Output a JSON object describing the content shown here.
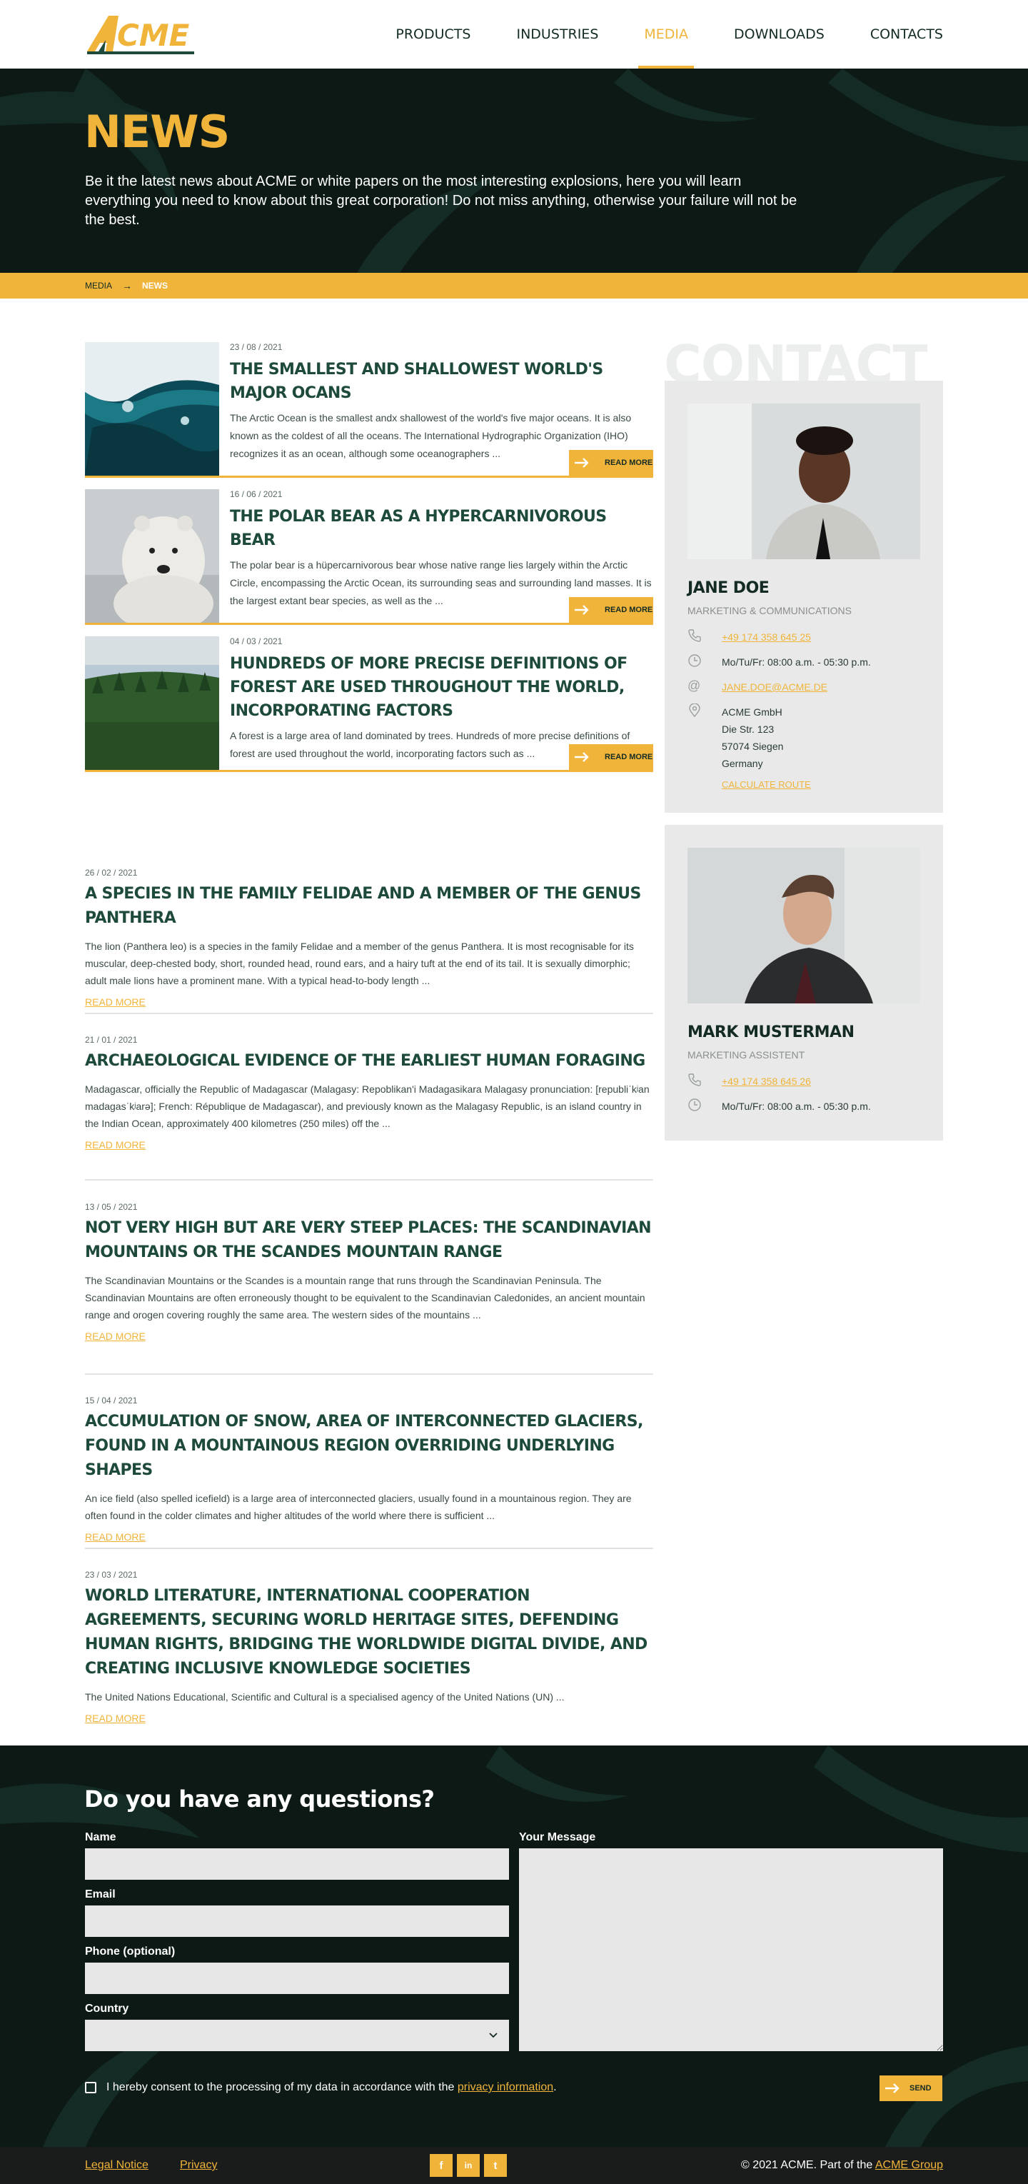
{
  "header": {
    "logo_text": "ACME",
    "nav": [
      "PRODUCTS",
      "INDUSTRIES",
      "MEDIA",
      "DOWNLOADS",
      "CONTACTS"
    ],
    "active_nav": "MEDIA"
  },
  "hero": {
    "title": "NEWS",
    "text": "Be it the latest news about ACME or white papers on the most interesting explosions, here you will learn everything you need to know about this great corporation! Do not miss anything, otherwise your failure will not be the best."
  },
  "breadcrumb": {
    "parent": "MEDIA",
    "current": "NEWS"
  },
  "featured": [
    {
      "date": "23 / 08 / 2021",
      "title": "THE SMALLEST AND SHALLOWEST WORLD'S MAJOR OCANS",
      "text": "The Arctic Ocean is the smallest andx shallowest of the world's five major oceans. It is also known as the coldest of all the oceans. The International Hydrographic Organization (IHO) recognizes it as an ocean, although some oceanographers ...",
      "button": "READ MORE"
    },
    {
      "date": "16 / 06 / 2021",
      "title": "THE POLAR BEAR AS A HYPERCARNIVOROUS BEAR",
      "text": "The polar bear     is a hüpercarnivorous bear whose native range lies largely within the Arctic Circle, encompassing the Arctic Ocean, its surrounding seas and surrounding land masses. It is the largest extant bear species, as well as the ...",
      "button": "READ MORE"
    },
    {
      "date": "04 / 03 / 2021",
      "title": "HUNDREDS OF MORE PRECISE DEFINITIONS OF FOREST ARE USED THROUGHOUT THE WORLD, INCORPORATING FACTORS",
      "text": "A forest is a large area of land dominated by trees. Hundreds of more precise definitions of forest are used throughout the world, incorporating factors such as ...",
      "button": "READ MORE"
    }
  ],
  "articles": [
    {
      "date": "26 / 02 / 2021",
      "title": "A SPECIES IN THE FAMILY FELIDAE AND A MEMBER OF THE GENUS PANTHERA",
      "text": "The lion (Panthera leo) is a species in the family Felidae and a member of the genus Panthera. It is most recognisable for its muscular, deep-chested body, short, rounded head, round ears, and a hairy tuft at the end of its tail. It is sexually dimorphic; adult male lions have a prominent mane. With a typical head-to-body length ...",
      "more": "READ MORE"
    },
    {
      "date": "21 / 01 / 2021",
      "title": "ARCHAEOLOGICAL EVIDENCE OF THE EARLIEST HUMAN FORAGING",
      "text": "Madagascar, officially the Republic of Madagascar (Malagasy: Repoblikan'i Madagasikara Malagasy pronunciation: [republiˈkʲan madaɡasˈkʲarə]; French: République de Madagascar), and previously known as the Malagasy Republic, is an island country in the Indian Ocean, approximately 400 kilometres (250 miles) off the ...",
      "more": "READ MORE"
    },
    {
      "date": "13 / 05 / 2021",
      "title": "NOT VERY HIGH BUT ARE VERY STEEP PLACES: THE SCANDINAVIAN MOUNTAINS OR THE SCANDES MOUNTAIN RANGE",
      "text": "The Scandinavian Mountains or the Scandes is a mountain range that runs through the Scandinavian Peninsula. The Scandinavian Mountains are often erroneously thought to be equivalent to the Scandinavian Caledonides, an ancient mountain range and orogen covering roughly the same area. The western sides of the mountains ...",
      "more": "READ MORE"
    },
    {
      "date": "15 / 04 / 2021",
      "title": "ACCUMULATION OF SNOW, AREA OF INTERCONNECTED GLACIERS, FOUND IN A MOUNTAINOUS REGION OVERRIDING UNDERLYING SHAPES",
      "text": "An ice field (also spelled icefield) is a large area of interconnected glaciers, usually found in a mountainous region. They are often found in the colder climates and higher altitudes of the world where there is sufficient ...",
      "more": "READ MORE"
    },
    {
      "date": "23 / 03 / 2021",
      "title": "WORLD LITERATURE, INTERNATIONAL COOPERATION AGREEMENTS, SECURING WORLD HERITAGE SITES, DEFENDING HUMAN RIGHTS, BRIDGING THE WORLDWIDE DIGITAL DIVIDE, AND CREATING INCLUSIVE KNOWLEDGE SOCIETIES",
      "text": "The United Nations Educational, Scientific and Cultural is a specialised agency of the United Nations (UN)  ...",
      "more": "READ MORE"
    }
  ],
  "sidebar": {
    "heading": "CONTACT",
    "contact1": {
      "name": "JANE DOE",
      "role": "MARKETING & COMMUNICATIONS",
      "phone": "+49 174 358 645 25",
      "hours": "Mo/Tu/Fr: 08:00 a.m. - 05:30 p.m.",
      "email": "JANE.DOE@ACME.DE",
      "address": [
        "ACME GmbH",
        "Die Str. 123",
        "57074 Siegen",
        "Germany"
      ],
      "route": "CALCULATE ROUTE"
    },
    "contact2": {
      "name": "MARK MUSTERMAN",
      "role": "MARKETING ASSISTENT",
      "phone": "+49 174 358 645 26",
      "hours": "Mo/Tu/Fr: 08:00 a.m. - 05:30 p.m."
    }
  },
  "form": {
    "title": "Do you have any questions?",
    "name_label": "Name",
    "email_label": "Email",
    "phone_label": "Phone (optional)",
    "country_label": "Country",
    "message_label": "Your Message",
    "consent_text": "I hereby consent to the processing of my data in accordance with the",
    "consent_link": "privacy information",
    "consent_end": ".",
    "send": "SEND"
  },
  "footer": {
    "legal": "Legal Notice",
    "privacy": "Privacy",
    "socials": [
      "f",
      "in",
      "t"
    ],
    "copyright": "© 2021 ACME. Part of the",
    "group": "ACME Group"
  },
  "colors": {
    "accent": "#f0b43a",
    "dark": "#0c1915",
    "heading": "#1e4a3c",
    "panel": "#e8e9e8"
  }
}
